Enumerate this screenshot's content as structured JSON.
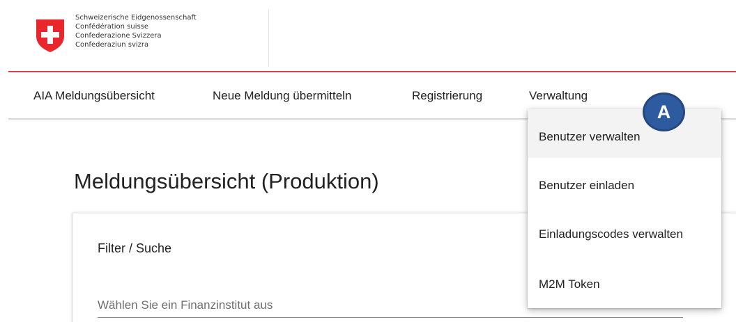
{
  "header": {
    "logo_lines": [
      "Schweizerische Eidgenossenschaft",
      "Confédération suisse",
      "Confederazione Svizzera",
      "Confederaziun svizra"
    ]
  },
  "nav": {
    "items": [
      {
        "label": "AIA Meldungsübersicht"
      },
      {
        "label": "Neue Meldung übermitteln"
      },
      {
        "label": "Registrierung"
      },
      {
        "label": "Verwaltung"
      }
    ]
  },
  "main": {
    "title": "Meldungsübersicht (Produktion)",
    "card": {
      "title": "Filter / Suche",
      "select_placeholder": "Wählen Sie ein Finanzinstitut aus"
    }
  },
  "dropdown": {
    "items": [
      {
        "label": "Benutzer verwalten"
      },
      {
        "label": "Benutzer einladen"
      },
      {
        "label": "Einladungscodes verwalten"
      },
      {
        "label": "M2M Token"
      }
    ]
  },
  "annotation": {
    "badge_label": "A",
    "badge_color": "#2e5aa0"
  },
  "colors": {
    "brand_red": "#dc3f48",
    "shield_red": "#e8262b"
  }
}
